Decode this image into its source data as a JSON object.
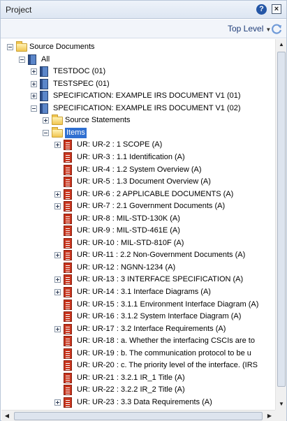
{
  "window": {
    "title": "Project"
  },
  "toolbar": {
    "level_label": "Top Level"
  },
  "tree": [
    {
      "label": "Source Documents",
      "depth": 0,
      "expander": "minus",
      "icon": "folder"
    },
    {
      "label": "All",
      "depth": 1,
      "expander": "minus",
      "icon": "book"
    },
    {
      "label": "TESTDOC (01)",
      "depth": 2,
      "expander": "plus",
      "icon": "book"
    },
    {
      "label": "TESTSPEC (01)",
      "depth": 2,
      "expander": "plus",
      "icon": "book"
    },
    {
      "label": "SPECIFICATION: EXAMPLE IRS DOCUMENT V1 (01)",
      "depth": 2,
      "expander": "plus",
      "icon": "book"
    },
    {
      "label": "SPECIFICATION: EXAMPLE IRS DOCUMENT V1 (02)",
      "depth": 2,
      "expander": "minus",
      "icon": "book"
    },
    {
      "label": "Source Statements",
      "depth": 3,
      "expander": "plus",
      "icon": "folder"
    },
    {
      "label": "Items",
      "depth": 3,
      "expander": "minus",
      "icon": "folder",
      "selected": true
    },
    {
      "label": "UR: UR-2 : 1 SCOPE (A)",
      "depth": 4,
      "expander": "plus",
      "icon": "doc"
    },
    {
      "label": "UR: UR-3 : 1.1 Identification (A)",
      "depth": 4,
      "expander": "none",
      "icon": "doc"
    },
    {
      "label": "UR: UR-4 : 1.2 System Overview (A)",
      "depth": 4,
      "expander": "none",
      "icon": "doc"
    },
    {
      "label": "UR: UR-5 : 1.3 Document Overview (A)",
      "depth": 4,
      "expander": "none",
      "icon": "doc"
    },
    {
      "label": "UR: UR-6 : 2 APPLICABLE DOCUMENTS (A)",
      "depth": 4,
      "expander": "plus",
      "icon": "doc"
    },
    {
      "label": "UR: UR-7 : 2.1 Government Documents (A)",
      "depth": 4,
      "expander": "plus",
      "icon": "doc"
    },
    {
      "label": "UR: UR-8 : MIL-STD-130K (A)",
      "depth": 4,
      "expander": "none",
      "icon": "doc"
    },
    {
      "label": "UR: UR-9 : MIL-STD-461E (A)",
      "depth": 4,
      "expander": "none",
      "icon": "doc"
    },
    {
      "label": "UR: UR-10 : MIL-STD-810F (A)",
      "depth": 4,
      "expander": "none",
      "icon": "doc"
    },
    {
      "label": "UR: UR-11 : 2.2 Non-Government Documents (A)",
      "depth": 4,
      "expander": "plus",
      "icon": "doc"
    },
    {
      "label": "UR: UR-12 : NGNN-1234 (A)",
      "depth": 4,
      "expander": "none",
      "icon": "doc"
    },
    {
      "label": "UR: UR-13 : 3 INTERFACE SPECIFICATION (A)",
      "depth": 4,
      "expander": "plus",
      "icon": "doc"
    },
    {
      "label": "UR: UR-14 : 3.1 Interface Diagrams (A)",
      "depth": 4,
      "expander": "plus",
      "icon": "doc"
    },
    {
      "label": "UR: UR-15 : 3.1.1 Environment Interface Diagram (A)",
      "depth": 4,
      "expander": "none",
      "icon": "doc"
    },
    {
      "label": "UR: UR-16 : 3.1.2 System Interface Diagram (A)",
      "depth": 4,
      "expander": "none",
      "icon": "doc"
    },
    {
      "label": "UR: UR-17 : 3.2 Interface Requirements (A)",
      "depth": 4,
      "expander": "plus",
      "icon": "doc"
    },
    {
      "label": "UR: UR-18 : a.    Whether the interfacing CSCIs are to",
      "depth": 4,
      "expander": "none",
      "icon": "doc"
    },
    {
      "label": "UR: UR-19 : b.    The communication protocol to be u",
      "depth": 4,
      "expander": "none",
      "icon": "doc"
    },
    {
      "label": "UR: UR-20 : c.    The priority level of the interface. (IRS",
      "depth": 4,
      "expander": "none",
      "icon": "doc"
    },
    {
      "label": "UR: UR-21 : 3.2.1 IR_1 Title (A)",
      "depth": 4,
      "expander": "none",
      "icon": "doc"
    },
    {
      "label": "UR: UR-22 : 3.2.2 IR_2 Title (A)",
      "depth": 4,
      "expander": "none",
      "icon": "doc"
    },
    {
      "label": "UR: UR-23 : 3.3 Data Requirements (A)",
      "depth": 4,
      "expander": "plus",
      "icon": "doc"
    }
  ]
}
